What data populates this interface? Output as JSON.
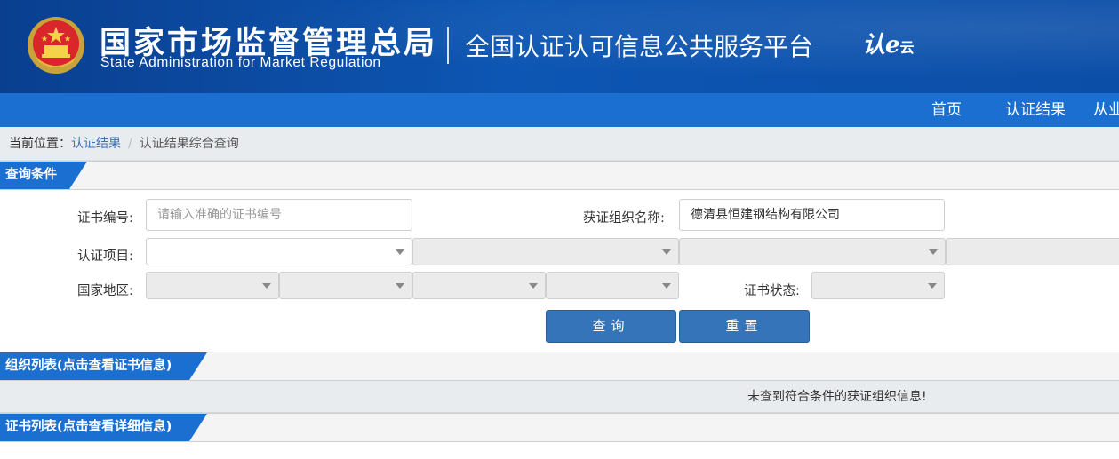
{
  "header": {
    "title_cn": "国家市场监督管理总局",
    "title_en": "State Administration  for  Market Regulation",
    "platform": "全国认证认可信息公共服务平台",
    "cloud_logo_main": "认e",
    "cloud_logo_small": "云"
  },
  "nav": {
    "items": [
      {
        "label": "首页"
      },
      {
        "label": "认证结果"
      },
      {
        "label": "从业"
      }
    ]
  },
  "breadcrumb": {
    "prefix": "当前位置：",
    "link": "认证结果",
    "separator": "/",
    "current": "认证结果综合查询"
  },
  "query": {
    "section_title": "查询条件",
    "cert_no_label": "证书编号:",
    "cert_no_placeholder": "请输入准确的证书编号",
    "org_name_label": "获证组织名称:",
    "org_name_value": "德清县恒建钢结构有限公司",
    "project_label": "认证项目:",
    "region_label": "国家地区:",
    "status_label": "证书状态:",
    "search_button": "查询",
    "reset_button": "重置"
  },
  "org_list": {
    "section_title": "组织列表(点击查看证书信息)",
    "empty_message": "未查到符合条件的获证组织信息!"
  },
  "cert_list": {
    "section_title": "证书列表(点击查看详细信息)"
  },
  "colors": {
    "banner": "#0d56b3",
    "nav": "#1a6fd0",
    "button": "#3574b9",
    "link": "#3a6fb5"
  }
}
